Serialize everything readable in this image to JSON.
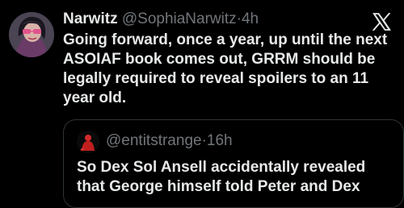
{
  "tweet": {
    "display_name": "Narwitz",
    "handle": "@SophiaNarwitz",
    "separator": "·",
    "time": "4h",
    "text": "Going forward, once a year, up until the next ASOIAF book comes out, GRRM should be legally required to reveal spoilers to an 11 year old.",
    "avatar_icon": "avatar-woman-pink-glasses-icon",
    "platform_icon": "x-logo-icon"
  },
  "quote": {
    "handle": "@entitstrange",
    "separator": "·",
    "time": "16h",
    "text": "So Dex Sol Ansell accidentally revealed that George himself told Peter and Dex",
    "avatar_icon": "avatar-red-figure-icon"
  },
  "colors": {
    "background": "#000000",
    "text_primary": "#e7e9ea",
    "text_secondary": "#71767b",
    "border": "#2f3336"
  }
}
